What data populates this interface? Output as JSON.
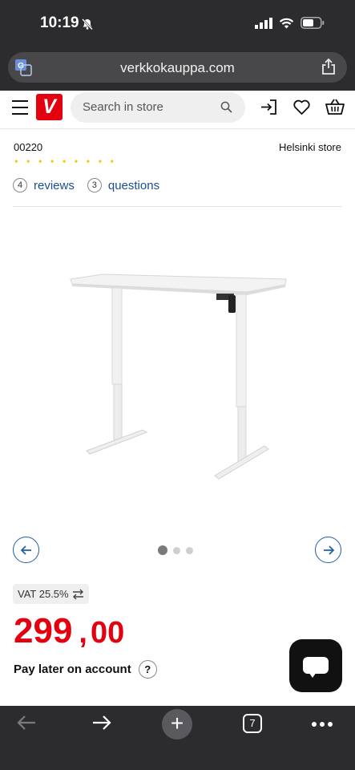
{
  "status_bar": {
    "time": "10:19"
  },
  "browser": {
    "url": "verkkokauppa.com",
    "open_tabs": "7"
  },
  "header": {
    "logo_letter": "V",
    "search_placeholder": "Search in store"
  },
  "product": {
    "sku": "00220",
    "store": "Helsinki store",
    "reviews_count": "4",
    "reviews_label": "reviews",
    "questions_count": "3",
    "questions_label": "questions",
    "image_count": 3,
    "active_image": 1,
    "vat_label": "VAT 25.5%",
    "price_whole": "299",
    "price_separator": ",",
    "price_cents": "00",
    "pay_later_label": "Pay later on account",
    "pay_later_help": "?"
  },
  "colors": {
    "brand_red": "#e3000f",
    "link_blue": "#1a4f8b",
    "chrome_dark": "#2c2c2e"
  },
  "icons": [
    "translate-icon",
    "share-icon",
    "hamburger-menu-icon",
    "search-icon",
    "login-icon",
    "heart-icon",
    "basket-icon",
    "chevron-left-icon",
    "chevron-right-icon",
    "swap-icon",
    "chat-icon",
    "back-arrow-icon",
    "forward-arrow-icon",
    "plus-icon",
    "tabs-icon",
    "more-icon"
  ]
}
